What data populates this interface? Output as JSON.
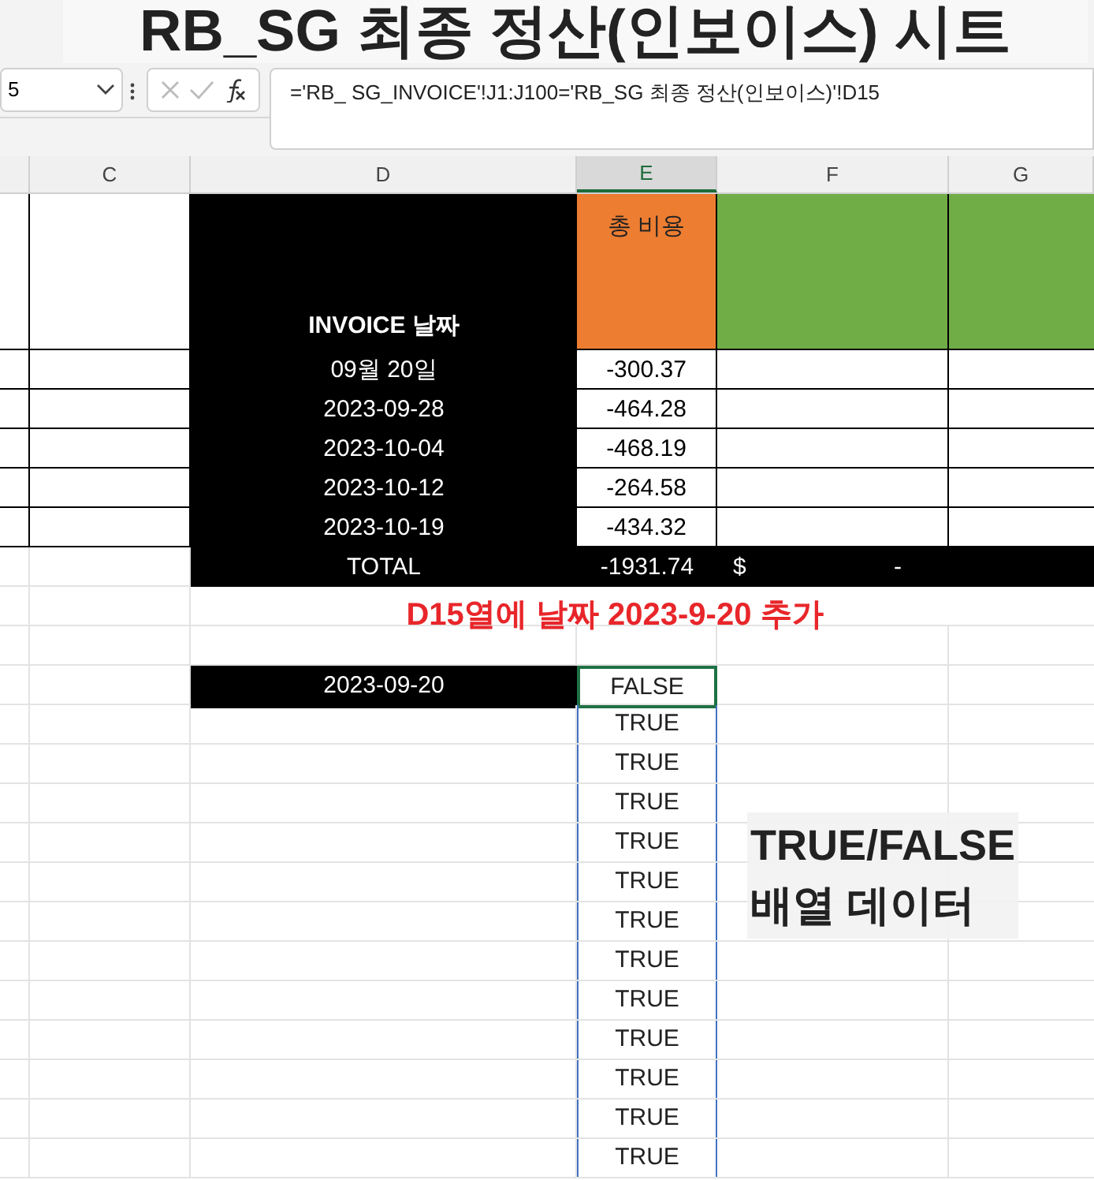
{
  "title_overlay": "RB_SG 최종 정산(인보이스) 시트",
  "name_box": "5",
  "formula": "='RB_ SG_INVOICE'!J1:J100='RB_SG 최종 정산(인보이스)'!D15",
  "columns": [
    {
      "label": "C",
      "selected": false
    },
    {
      "label": "D",
      "selected": false
    },
    {
      "label": "E",
      "selected": true
    },
    {
      "label": "F",
      "selected": false
    },
    {
      "label": "G",
      "selected": false
    }
  ],
  "header": {
    "date_label": "INVOICE 날짜",
    "cost_label": "총 비용"
  },
  "invoices": [
    {
      "date": "09월 20일",
      "cost": "-300.37"
    },
    {
      "date": "2023-09-28",
      "cost": "-464.28"
    },
    {
      "date": "2023-10-04",
      "cost": "-468.19"
    },
    {
      "date": "2023-10-12",
      "cost": "-264.58"
    },
    {
      "date": "2023-10-19",
      "cost": "-434.32"
    }
  ],
  "total": {
    "label": "TOTAL",
    "cost": "-1931.74",
    "currency": "$",
    "dash": "-"
  },
  "note": "D15열에 날짜 2023-9-20 추가",
  "lookup": {
    "date": "2023-09-20"
  },
  "results": [
    {
      "value": "FALSE",
      "selected": true
    },
    {
      "value": "TRUE",
      "selected": false
    },
    {
      "value": "TRUE",
      "selected": false
    },
    {
      "value": "TRUE",
      "selected": false
    },
    {
      "value": "TRUE",
      "selected": false
    },
    {
      "value": "TRUE",
      "selected": false
    },
    {
      "value": "TRUE",
      "selected": false
    },
    {
      "value": "TRUE",
      "selected": false
    },
    {
      "value": "TRUE",
      "selected": false
    },
    {
      "value": "TRUE",
      "selected": false
    },
    {
      "value": "TRUE",
      "selected": false
    },
    {
      "value": "TRUE",
      "selected": false
    },
    {
      "value": "TRUE",
      "selected": false
    }
  ],
  "callout": [
    "TRUE/FALSE",
    "배열 데이터"
  ]
}
